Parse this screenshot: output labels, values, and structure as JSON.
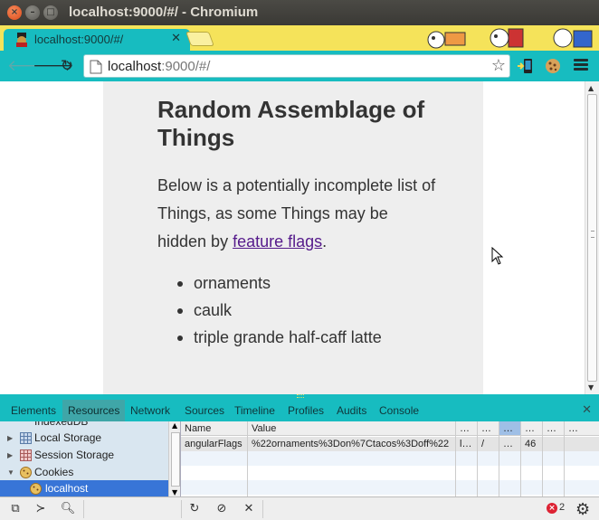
{
  "window": {
    "title": "localhost:9000/#/ - Chromium"
  },
  "tab": {
    "title": "localhost:9000/#/"
  },
  "omnibox": {
    "host": "localhost",
    "rest": ":9000/#/"
  },
  "page": {
    "heading": "Random Assemblage of Things",
    "intro_before": "Below is a potentially incomplete list of Things, as some Things may be hidden by ",
    "intro_link": "feature flags",
    "intro_after": ".",
    "things": [
      "ornaments",
      "caulk",
      "triple grande half-caff latte"
    ]
  },
  "devtools": {
    "tabs": [
      "Elements",
      "Resources",
      "Network",
      "Sources",
      "Timeline",
      "Profiles",
      "Audits",
      "Console"
    ],
    "active_tab": "Resources",
    "sidebar": {
      "cut_item": "IndexedDB",
      "items": [
        "Local Storage",
        "Session Storage",
        "Cookies"
      ],
      "selected": "localhost"
    },
    "grid": {
      "headers": [
        "Name",
        "Value",
        "…",
        "…",
        "…",
        "…",
        "…",
        "…"
      ],
      "row": [
        "angularFlags",
        "%22ornaments%3Don%7Ctacos%3Doff%22",
        "l…",
        "/",
        "…",
        "46",
        "",
        ""
      ]
    },
    "error_count": "2"
  },
  "colors": {
    "accent": "#17bcc0",
    "tabstrip": "#f5e35a",
    "link": "#551a8b"
  }
}
